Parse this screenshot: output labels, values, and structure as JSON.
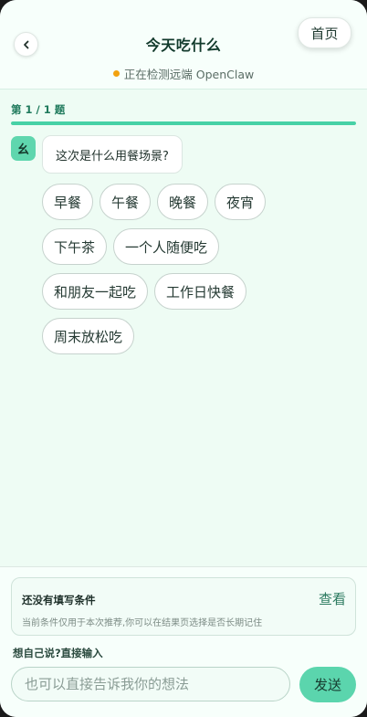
{
  "header": {
    "title": "今天吃什么",
    "home_label": "首页",
    "status_text": "正在检测远端 OpenClaw",
    "status_color": "#f2a20f"
  },
  "progress": {
    "label": "第 1 / 1 题",
    "fraction": 1.0
  },
  "chat": {
    "avatar_text": "幺",
    "question": "这次是什么用餐场景?",
    "options": [
      [
        "早餐",
        "午餐",
        "晚餐",
        "夜宵"
      ],
      [
        "下午茶",
        "一个人随便吃"
      ],
      [
        "和朋友一起吃",
        "工作日快餐"
      ],
      [
        "周末放松吃"
      ]
    ]
  },
  "conditions": {
    "title": "还没有填写条件",
    "subtitle": "当前条件仅用于本次推荐,你可以在结果页选择是否长期记住",
    "link_label": "查看"
  },
  "input": {
    "label": "想自己说?直接输入",
    "placeholder": "也可以直接告诉我你的想法",
    "send_label": "发送"
  },
  "colors": {
    "accent": "#47d1a6",
    "background": "#eefcf4"
  }
}
